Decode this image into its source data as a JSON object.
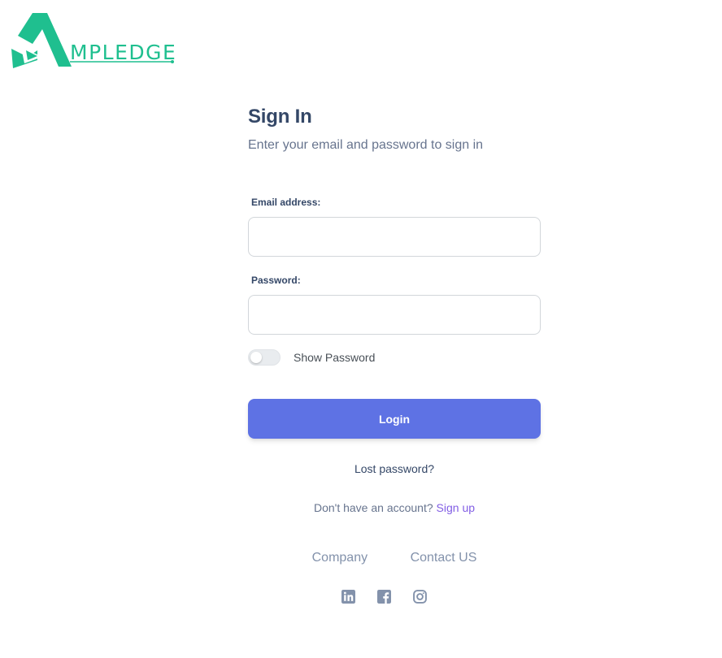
{
  "brand": {
    "logo_text": "MPLEDGE",
    "logo_color": "#1fbf8f"
  },
  "signin": {
    "title": "Sign In",
    "subtitle": "Enter your email and password to sign in",
    "email_label": "Email address:",
    "email_value": "",
    "password_label": "Password:",
    "password_value": "",
    "show_password_label": "Show Password",
    "show_password_on": false,
    "login_label": "Login",
    "lost_password_label": "Lost password?",
    "no_account_text": "Don't have an account?",
    "signup_label": "Sign up"
  },
  "footer": {
    "links": [
      "Company",
      "Contact US"
    ],
    "social_icons": [
      "linkedin-icon",
      "facebook-icon",
      "instagram-icon"
    ]
  },
  "colors": {
    "primary": "#5e72e4",
    "link": "#825ee4",
    "text": "#344767",
    "muted": "#67748e"
  }
}
